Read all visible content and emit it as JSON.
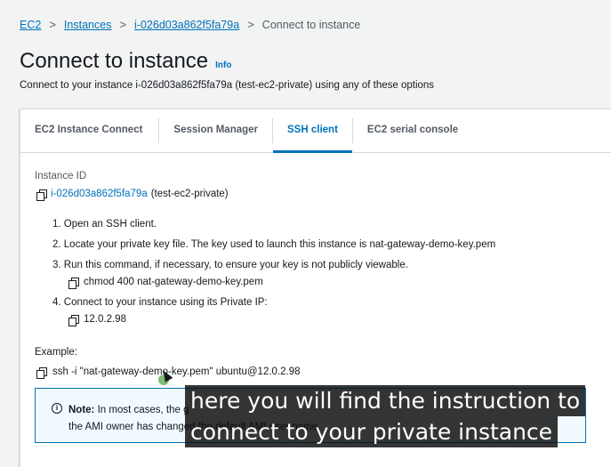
{
  "breadcrumb": {
    "items": [
      "EC2",
      "Instances",
      "i-026d03a862f5fa79a"
    ],
    "current": "Connect to instance",
    "separator": ">"
  },
  "page": {
    "title": "Connect to instance",
    "info": "Info",
    "subtitle": "Connect to your instance i-026d03a862f5fa79a (test-ec2-private) using any of these options"
  },
  "tabs": [
    {
      "label": "EC2 Instance Connect"
    },
    {
      "label": "Session Manager"
    },
    {
      "label": "SSH client"
    },
    {
      "label": "EC2 serial console"
    }
  ],
  "active_tab": "SSH client",
  "instance": {
    "label": "Instance ID",
    "id": "i-026d03a862f5fa79a",
    "name": "(test-ec2-private)"
  },
  "steps": [
    "1. Open an SSH client.",
    "2. Locate your private key file. The key used to launch this instance is nat-gateway-demo-key.pem",
    "3. Run this command, if necessary, to ensure your key is not publicly viewable.",
    "4. Connect to your instance using its Private IP:"
  ],
  "commands": {
    "chmod": "chmod 400 nat-gateway-demo-key.pem",
    "private_ip": "12.0.2.98"
  },
  "example": {
    "label": "Example:",
    "command": "ssh -i \"nat-gateway-demo-key.pem\" ubuntu@12.0.2.98"
  },
  "note": {
    "icon": "info-icon",
    "bold": "Note:",
    "line1": "In most cases, the g",
    "line2": "the AMI owner has changed the default AMI user name."
  },
  "caption": {
    "line1": "here you will find the instruction to",
    "line2": "connect to your private instance"
  },
  "colors": {
    "link": "#0073bb",
    "background": "#f2f3f3",
    "note_background": "#f1faff"
  }
}
